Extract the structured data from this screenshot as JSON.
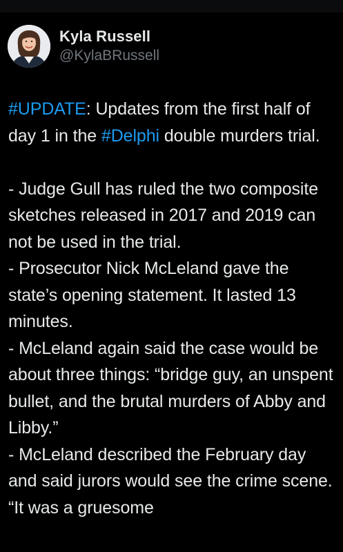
{
  "author": {
    "display_name": "Kyla Russell",
    "handle": "@KylaBRussell"
  },
  "tweet": {
    "line1_hashtag": "#UPDATE",
    "line1_text_a": ": Updates from the first half of day 1 in the ",
    "line1_hashtag2": "#Delphi",
    "line1_text_b": " double murders trial.",
    "bullets": [
      "- Judge Gull has ruled the two composite sketches released in 2017 and 2019 can not be used in the trial.",
      "- Prosecutor Nick McLeland gave the state’s opening statement. It lasted 13 minutes.",
      "- McLeland again said the case would be about three things: “bridge guy, an unspent bullet, and the brutal murders of Abby and Libby.”",
      "- McLeland described the February day and said jurors would see the crime scene. “It was a gruesome"
    ]
  },
  "colors": {
    "background": "#000000",
    "text": "#e7e9ea",
    "secondary_text": "#71767b",
    "link": "#1d9bf0"
  }
}
